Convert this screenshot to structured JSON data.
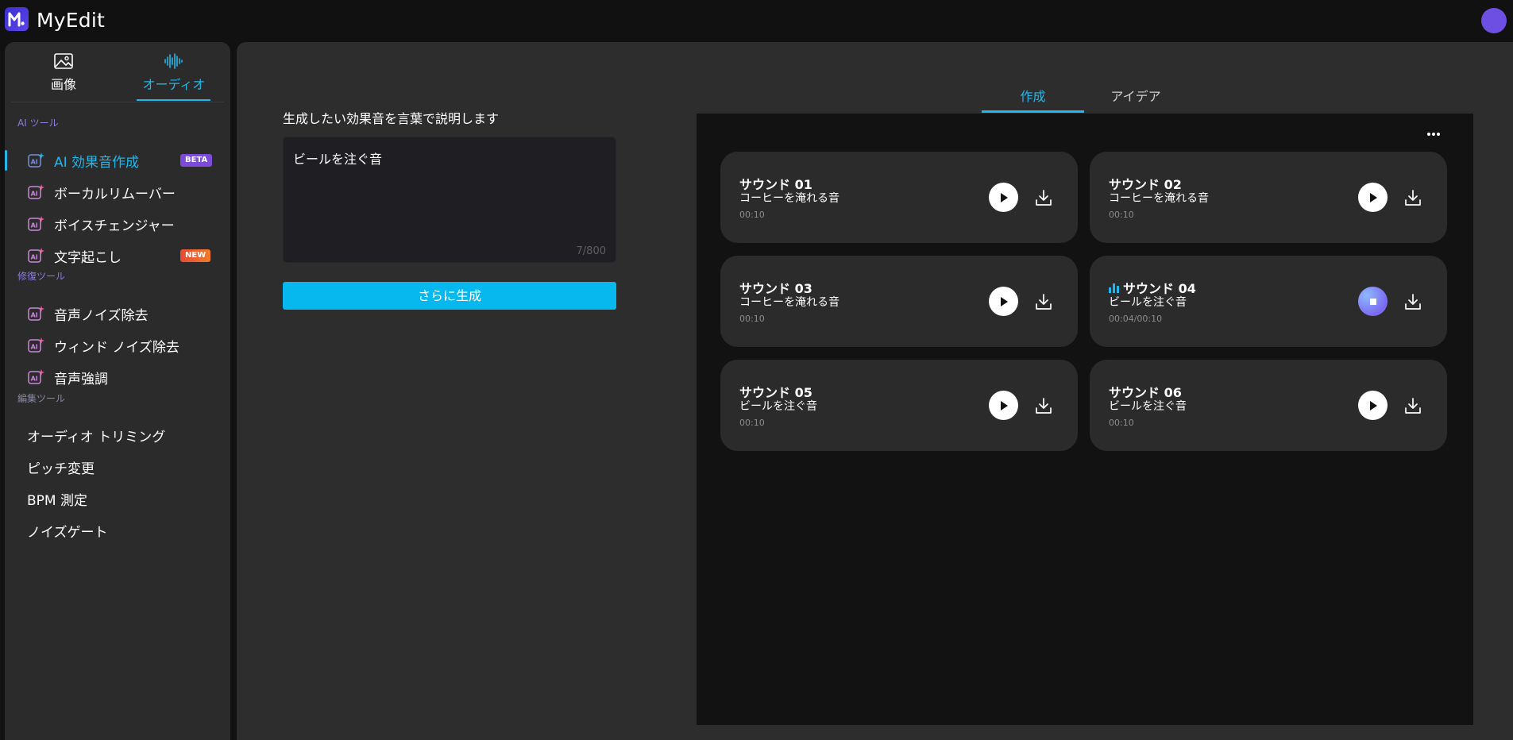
{
  "app": {
    "title": "MyEdit"
  },
  "colors": {
    "accent": "#23b6ea",
    "button": "#06b8ee",
    "avatar": "#6e4fe3"
  },
  "sidebar": {
    "modes": [
      {
        "label": "画像",
        "icon": "image-icon"
      },
      {
        "label": "オーディオ",
        "icon": "audio-wave-icon",
        "active": true
      }
    ],
    "sections": {
      "ai_tools": "AI ツール",
      "repair_tools": "修復ツール",
      "edit_tools": "編集ツール"
    },
    "ai_items": [
      {
        "label": "AI 効果音作成",
        "badge": "BETA",
        "active": true
      },
      {
        "label": "ボーカルリムーバー"
      },
      {
        "label": "ボイスチェンジャー"
      },
      {
        "label": "文字起こし",
        "badge": "NEW"
      }
    ],
    "repair_items": [
      {
        "label": "音声ノイズ除去"
      },
      {
        "label": "ウィンド ノイズ除去"
      },
      {
        "label": "音声強調"
      }
    ],
    "edit_items": [
      {
        "label": "オーディオ トリミング"
      },
      {
        "label": "ピッチ変更"
      },
      {
        "label": "BPM 測定"
      },
      {
        "label": "ノイズゲート"
      }
    ]
  },
  "prompt": {
    "label": "生成したい効果音を言葉で説明します",
    "value": "ビールを注ぐ音",
    "char_count": "7/800",
    "generate_label": "さらに生成"
  },
  "result_tabs": [
    {
      "label": "作成",
      "active": true
    },
    {
      "label": "アイデア"
    }
  ],
  "sounds": [
    {
      "title": "サウンド 01",
      "desc": "コーヒーを淹れる音",
      "time": "00:10"
    },
    {
      "title": "サウンド 02",
      "desc": "コーヒーを淹れる音",
      "time": "00:10"
    },
    {
      "title": "サウンド 03",
      "desc": "コーヒーを淹れる音",
      "time": "00:10"
    },
    {
      "title": "サウンド 04",
      "desc": "ビールを注ぐ音",
      "time": "00:04/00:10",
      "playing": true
    },
    {
      "title": "サウンド 05",
      "desc": "ビールを注ぐ音",
      "time": "00:10"
    },
    {
      "title": "サウンド 06",
      "desc": "ビールを注ぐ音",
      "time": "00:10"
    }
  ]
}
